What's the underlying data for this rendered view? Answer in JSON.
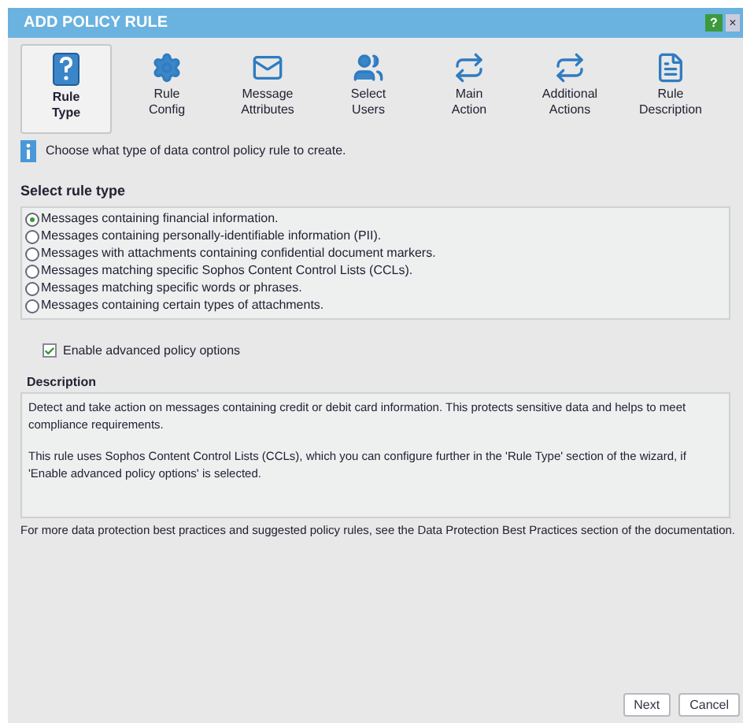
{
  "window": {
    "title": "ADD POLICY RULE",
    "help": "?",
    "close": "×"
  },
  "steps": [
    {
      "label": "Rule Type",
      "kind": "question",
      "selected": true
    },
    {
      "label": "Rule Config",
      "kind": "gear",
      "selected": false
    },
    {
      "label": "Message Attributes",
      "kind": "mail",
      "selected": false
    },
    {
      "label": "Select Users",
      "kind": "users",
      "selected": false
    },
    {
      "label": "Main Action",
      "kind": "mailarrow",
      "selected": false
    },
    {
      "label": "Additional Actions",
      "kind": "mailarrow",
      "selected": false
    },
    {
      "label": "Rule Description",
      "kind": "doc",
      "selected": false
    }
  ],
  "info": "Choose what type of data control policy rule to create.",
  "rule_type": {
    "heading": "Select rule type",
    "options": [
      {
        "label": "Messages containing financial information.",
        "selected": true
      },
      {
        "label": "Messages containing personally-identifiable information (PII).",
        "selected": false
      },
      {
        "label": "Messages with attachments containing confidential document markers.",
        "selected": false
      },
      {
        "label": "Messages matching specific Sophos Content Control Lists (CCLs).",
        "selected": false
      },
      {
        "label": "Messages matching specific words or phrases.",
        "selected": false
      },
      {
        "label": "Messages containing certain types of attachments.",
        "selected": false
      }
    ]
  },
  "advanced": {
    "label": "Enable advanced policy options",
    "checked": true
  },
  "description": {
    "heading": "Description",
    "paragraphs": [
      "Detect and take action on messages containing credit or debit card information. This protects sensitive data and helps to meet compliance requirements.",
      "This rule uses Sophos Content Control Lists (CCLs), which you can configure further in the 'Rule Type' section of the wizard, if 'Enable advanced policy options' is selected."
    ]
  },
  "footer_note": "For more data protection best practices and suggested policy rules, see the Data Protection Best Practices section of the documentation.",
  "buttons": [
    "Next",
    "Cancel"
  ]
}
